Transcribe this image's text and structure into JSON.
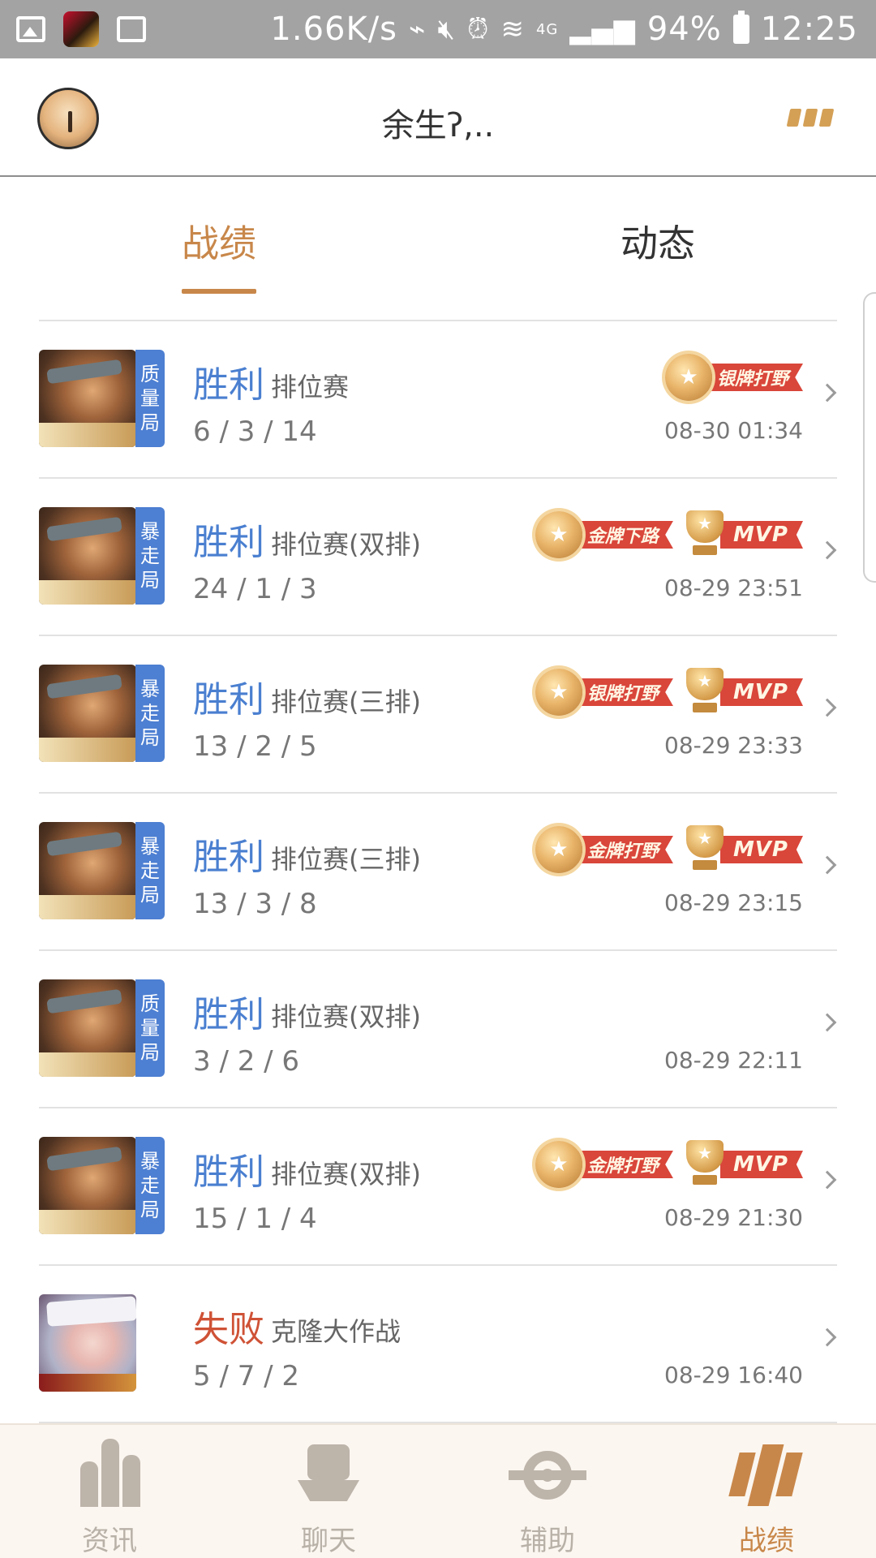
{
  "status_bar": {
    "net_speed": "1.66K/s",
    "signal_label": "4G",
    "battery": "94%",
    "time": "12:25",
    "icons": [
      "gallery-icon",
      "game-app-icon",
      "screenshot-icon",
      "usb-icon",
      "mute-icon",
      "alarm-icon",
      "wifi-icon",
      "signal-icon",
      "battery-icon"
    ]
  },
  "header": {
    "title": "余生ʔ,..",
    "menu_icon": "menu-icon"
  },
  "tabs": [
    {
      "label": "战绩",
      "active": true
    },
    {
      "label": "动态",
      "active": false
    }
  ],
  "matches": [
    {
      "tag": [
        "质",
        "量",
        "局"
      ],
      "result": "胜利",
      "mode": "排位赛",
      "kda": "6 / 3 / 14",
      "time": "08-30 01:34",
      "badges": [
        {
          "kind": "medal",
          "text": "银牌打野"
        }
      ]
    },
    {
      "tag": [
        "暴",
        "走",
        "局"
      ],
      "result": "胜利",
      "mode": "排位赛(双排)",
      "kda": "24 / 1 / 3",
      "time": "08-29 23:51",
      "badges": [
        {
          "kind": "medal",
          "text": "金牌下路"
        },
        {
          "kind": "mvp",
          "text": "MVP"
        }
      ]
    },
    {
      "tag": [
        "暴",
        "走",
        "局"
      ],
      "result": "胜利",
      "mode": "排位赛(三排)",
      "kda": "13 / 2 / 5",
      "time": "08-29 23:33",
      "badges": [
        {
          "kind": "medal",
          "text": "银牌打野"
        },
        {
          "kind": "mvp",
          "text": "MVP"
        }
      ]
    },
    {
      "tag": [
        "暴",
        "走",
        "局"
      ],
      "result": "胜利",
      "mode": "排位赛(三排)",
      "kda": "13 / 3 / 8",
      "time": "08-29 23:15",
      "badges": [
        {
          "kind": "medal",
          "text": "金牌打野"
        },
        {
          "kind": "mvp",
          "text": "MVP"
        }
      ]
    },
    {
      "tag": [
        "质",
        "量",
        "局"
      ],
      "result": "胜利",
      "mode": "排位赛(双排)",
      "kda": "3 / 2 / 6",
      "time": "08-29 22:11",
      "badges": []
    },
    {
      "tag": [
        "暴",
        "走",
        "局"
      ],
      "result": "胜利",
      "mode": "排位赛(双排)",
      "kda": "15 / 1 / 4",
      "time": "08-29 21:30",
      "badges": [
        {
          "kind": "medal",
          "text": "金牌打野"
        },
        {
          "kind": "mvp",
          "text": "MVP"
        }
      ]
    },
    {
      "tag": [],
      "result": "失败",
      "mode": "克隆大作战",
      "kda": "5 / 7 / 2",
      "time": "08-29 16:40",
      "badges": []
    }
  ],
  "bottom_nav": [
    {
      "label": "资讯",
      "icon": "news-icon"
    },
    {
      "label": "聊天",
      "icon": "chat-icon"
    },
    {
      "label": "辅助",
      "icon": "assist-icon"
    },
    {
      "label": "战绩",
      "icon": "record-icon",
      "active": true
    }
  ],
  "colors": {
    "accent": "#c8874a",
    "win": "#4a7fd0",
    "lose": "#cf5236",
    "tag_bg": "#4d7fd2",
    "badge_red": "#d9463a"
  }
}
